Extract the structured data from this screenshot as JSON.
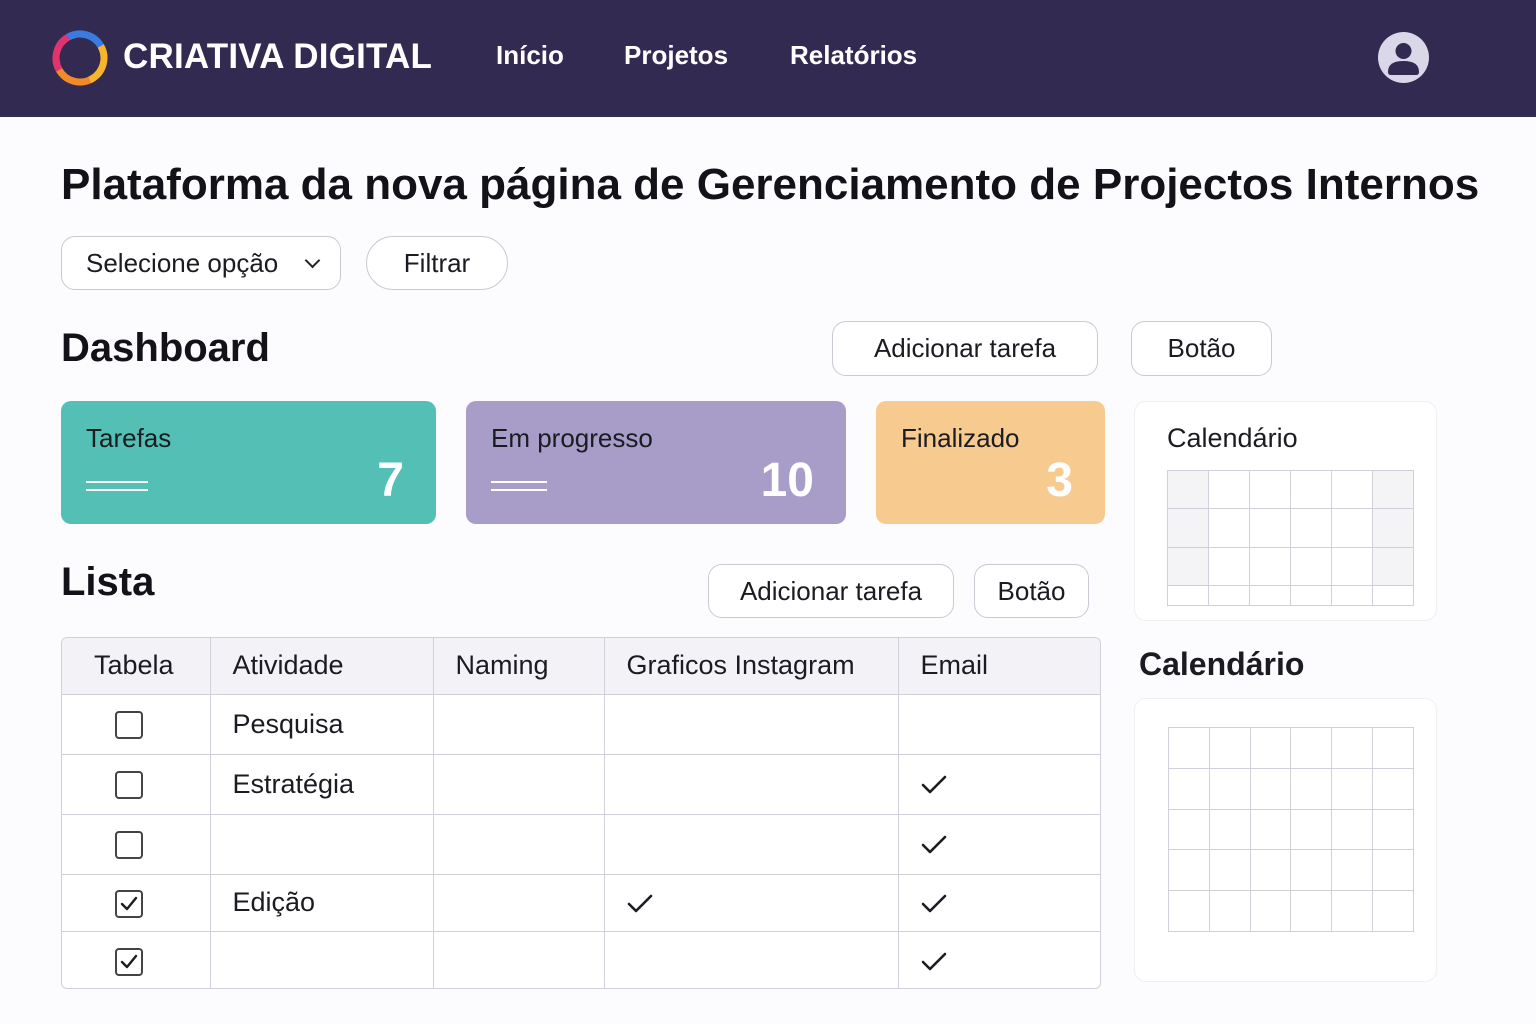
{
  "header": {
    "brand": "CRIATIVA DIGITAL",
    "nav": [
      "Início",
      "Projetos",
      "Relatórios"
    ],
    "logo_icon": "swirl-logo-icon",
    "avatar_icon": "user-avatar-icon"
  },
  "page": {
    "title": "Plataforma da nova página de Gerenciamento de Projectos Internos",
    "select_value": "Selecione opção",
    "filter_label": "Filtrar"
  },
  "dashboard": {
    "heading": "Dashboard",
    "add_task": "Adicionar tarefa",
    "button": "Botão",
    "cards": [
      {
        "label": "Tarefas",
        "value": "7",
        "color": "#54c0b5"
      },
      {
        "label": "Em progresso",
        "value": "10",
        "color": "#a89cc8"
      },
      {
        "label": "Finalizado",
        "value": "3",
        "color": "#f7cb8f"
      }
    ]
  },
  "calendar_1": {
    "title": "Calendário"
  },
  "calendar_2": {
    "title": "Calendário"
  },
  "list": {
    "heading": "Lista",
    "add_task": "Adicionar tarefa",
    "button": "Botão",
    "columns": [
      "Tabela",
      "Atividade",
      "Naming",
      "Graficos Instagram",
      "Email"
    ],
    "rows": [
      {
        "checked": false,
        "activity": "Pesquisa",
        "naming": false,
        "instagram": false,
        "email": false
      },
      {
        "checked": false,
        "activity": "Estratégia",
        "naming": false,
        "instagram": false,
        "email": true
      },
      {
        "checked": false,
        "activity": "",
        "naming": false,
        "instagram": false,
        "email": true
      },
      {
        "checked": true,
        "activity": "Edição",
        "naming": false,
        "instagram": true,
        "email": true
      },
      {
        "checked": true,
        "activity": "",
        "naming": false,
        "instagram": false,
        "email": true
      }
    ]
  },
  "colors": {
    "header_bg": "#332a52",
    "teal": "#54c0b5",
    "purple": "#a89cc8",
    "orange": "#f7cb8f"
  }
}
